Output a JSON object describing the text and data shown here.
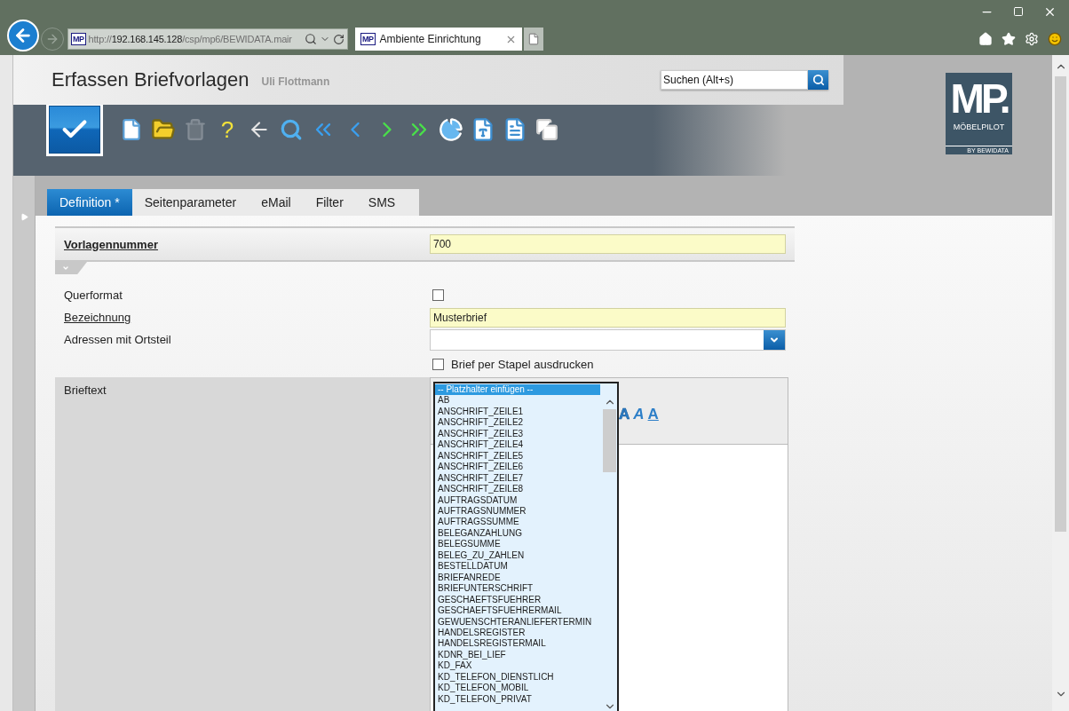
{
  "browser": {
    "favicon": "MP",
    "address": [
      {
        "text": "http://",
        "emphasis": false
      },
      {
        "text": "192.168.145.128",
        "emphasis": true
      },
      {
        "text": "/csp/mp6/BEWIDATA.mair",
        "emphasis": false
      }
    ],
    "tabs": [
      {
        "title": "Ambiente Einrichtung",
        "favicon": "MP",
        "selected": true
      }
    ]
  },
  "page": {
    "title": "Erfassen Briefvorlagen",
    "user": "Uli Flottmann",
    "search": {
      "placeholder": "Suchen (Alt+s)"
    }
  },
  "logo": {
    "mark": "MP.",
    "name": "MÖBELPILOT",
    "tagline": "BY BEWIDATA"
  },
  "toolbar": [
    {
      "kind": "new",
      "disabled": false
    },
    {
      "kind": "open",
      "disabled": false
    },
    {
      "kind": "delete",
      "disabled": true
    },
    {
      "kind": "help",
      "glyph": "?",
      "disabled": false
    },
    {
      "kind": "back",
      "disabled": false
    },
    {
      "kind": "search",
      "disabled": false
    },
    {
      "kind": "first",
      "disabled": false
    },
    {
      "kind": "prev",
      "disabled": false
    },
    {
      "kind": "next",
      "disabled": false
    },
    {
      "kind": "last",
      "disabled": false
    },
    {
      "kind": "chart",
      "disabled": false
    },
    {
      "kind": "text-doc",
      "disabled": false
    },
    {
      "kind": "doc",
      "disabled": false
    },
    {
      "kind": "copy",
      "disabled": false
    }
  ],
  "tabs": [
    {
      "label": "Definition *",
      "selected": true
    },
    {
      "label": "Seitenparameter",
      "selected": false
    },
    {
      "label": "eMail",
      "selected": false
    },
    {
      "label": "Filter",
      "selected": false
    },
    {
      "label": "SMS",
      "selected": false
    }
  ],
  "form": {
    "key_field": {
      "label": "Vorlagennummer",
      "value": "700"
    },
    "expanded": true,
    "fields": [
      {
        "kind": "checkbox",
        "label": "Querformat",
        "checked": false,
        "required": false
      },
      {
        "kind": "text",
        "label": "Bezeichnung",
        "value": "Musterbrief",
        "required": true
      },
      {
        "kind": "select",
        "label": "Adressen mit Ortsteil",
        "required": false
      },
      {
        "kind": "inline-checkbox",
        "text": "Brief per Stapel ausdrucken",
        "checked": false
      }
    ]
  },
  "brieftext": {
    "label": "Brieftext",
    "format_buttons": [
      {
        "kind": "bold",
        "label": "A"
      },
      {
        "kind": "italic",
        "label": "A"
      },
      {
        "kind": "underline",
        "label": "A"
      }
    ],
    "placeholder_list": {
      "items": [
        {
          "label": "-- Platzhalter einfügen --",
          "selected": true
        },
        {
          "label": "AB",
          "selected": false
        },
        {
          "label": "ANSCHRIFT_ZEILE1",
          "selected": false
        },
        {
          "label": "ANSCHRIFT_ZEILE2",
          "selected": false
        },
        {
          "label": "ANSCHRIFT_ZEILE3",
          "selected": false
        },
        {
          "label": "ANSCHRIFT_ZEILE4",
          "selected": false
        },
        {
          "label": "ANSCHRIFT_ZEILE5",
          "selected": false
        },
        {
          "label": "ANSCHRIFT_ZEILE6",
          "selected": false
        },
        {
          "label": "ANSCHRIFT_ZEILE7",
          "selected": false
        },
        {
          "label": "ANSCHRIFT_ZEILE8",
          "selected": false
        },
        {
          "label": "AUFTRAGSDATUM",
          "selected": false
        },
        {
          "label": "AUFTRAGSNUMMER",
          "selected": false
        },
        {
          "label": "AUFTRAGSSUMME",
          "selected": false
        },
        {
          "label": "BELEGANZAHLUNG",
          "selected": false
        },
        {
          "label": "BELEGSUMME",
          "selected": false
        },
        {
          "label": "BELEG_ZU_ZAHLEN",
          "selected": false
        },
        {
          "label": "BESTELLDATUM",
          "selected": false
        },
        {
          "label": "BRIEFANREDE",
          "selected": false
        },
        {
          "label": "BRIEFUNTERSCHRIFT",
          "selected": false
        },
        {
          "label": "GESCHAEFTSFUEHRER",
          "selected": false
        },
        {
          "label": "GESCHAEFTSFUEHRERMAIL",
          "selected": false
        },
        {
          "label": "GEWUENSCHTERANLIEFERTERMIN",
          "selected": false
        },
        {
          "label": "HANDELSREGISTER",
          "selected": false
        },
        {
          "label": "HANDELSREGISTERMAIL",
          "selected": false
        },
        {
          "label": "KDNR_BEI_LIEF",
          "selected": false
        },
        {
          "label": "KD_FAX",
          "selected": false
        },
        {
          "label": "KD_TELEFON_DIENSTLICH",
          "selected": false
        },
        {
          "label": "KD_TELEFON_MOBIL",
          "selected": false
        },
        {
          "label": "KD_TELEFON_PRIVAT",
          "selected": false
        }
      ]
    }
  }
}
